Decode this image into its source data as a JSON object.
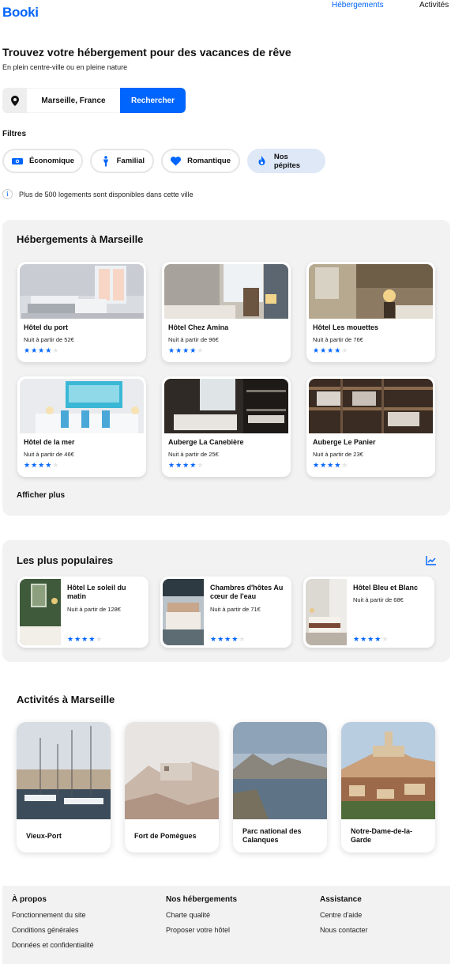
{
  "header": {
    "logo": "Booki",
    "nav": [
      "Hébergements",
      "Activités"
    ]
  },
  "hero": {
    "title": "Trouvez votre hébergement pour des vacances de rêve",
    "subtitle": "En plein centre-ville ou en pleine nature"
  },
  "search": {
    "value": "Marseille, France",
    "button_label": "Rechercher",
    "icon": "map-pin-icon"
  },
  "filters": {
    "title": "Filtres",
    "items": [
      {
        "label": "Économique",
        "icon": "money-icon",
        "active": false
      },
      {
        "label": "Familial",
        "icon": "child-icon",
        "active": false
      },
      {
        "label": "Romantique",
        "icon": "heart-icon",
        "active": false
      },
      {
        "label": "Nos pépites",
        "icon": "fire-icon",
        "active": true
      }
    ]
  },
  "info": {
    "text": "Plus de 500 logements sont disponibles dans cette ville",
    "icon": "info-icon"
  },
  "lodging": {
    "title": "Hébergements à Marseille",
    "items": [
      {
        "name": "Hôtel du port",
        "price": "Nuit à partir de 52€",
        "rating": 4
      },
      {
        "name": "Hôtel Chez Amina",
        "price": "Nuit à partir de 96€",
        "rating": 4
      },
      {
        "name": "Hôtel Les mouettes",
        "price": "Nuit à partir de 76€",
        "rating": 4
      },
      {
        "name": "Hôtel de la mer",
        "price": "Nuit à partir de 46€",
        "rating": 4
      },
      {
        "name": "Auberge La Canebière",
        "price": "Nuit à partir de 25€",
        "rating": 4
      },
      {
        "name": "Auberge Le Panier",
        "price": "Nuit à partir de 23€",
        "rating": 4
      }
    ],
    "show_more": "Afficher plus"
  },
  "popular": {
    "title": "Les plus populaires",
    "icon": "trend-chart-icon",
    "items": [
      {
        "name": "Hôtel Le soleil du matin",
        "price": "Nuit à partir de 128€",
        "rating": 4
      },
      {
        "name": "Chambres d'hôtes Au cœur de l'eau",
        "price": "Nuit à partir de 71€",
        "rating": 4
      },
      {
        "name": "Hôtel Bleu et Blanc",
        "price": "Nuit à partir de 68€",
        "rating": 4
      }
    ]
  },
  "activities": {
    "title": "Activités à Marseille",
    "items": [
      {
        "name": "Vieux-Port"
      },
      {
        "name": "Fort de Pomègues"
      },
      {
        "name": "Parc national des Calanques"
      },
      {
        "name": "Notre-Dame-de-la-Garde"
      }
    ]
  },
  "footer": {
    "columns": [
      {
        "heading": "À propos",
        "links": [
          "Fonctionnement du site",
          "Conditions générales",
          "Données et confidentialité"
        ]
      },
      {
        "heading": "Nos hébergements",
        "links": [
          "Charte qualité",
          "Proposer votre hôtel"
        ]
      },
      {
        "heading": "Assistance",
        "links": [
          "Centre d'aide",
          "Nous contacter"
        ]
      }
    ]
  },
  "colors": {
    "primary": "#0065FC",
    "chip_active": "#DEE8F7",
    "section_bg": "#F2F2F2"
  }
}
